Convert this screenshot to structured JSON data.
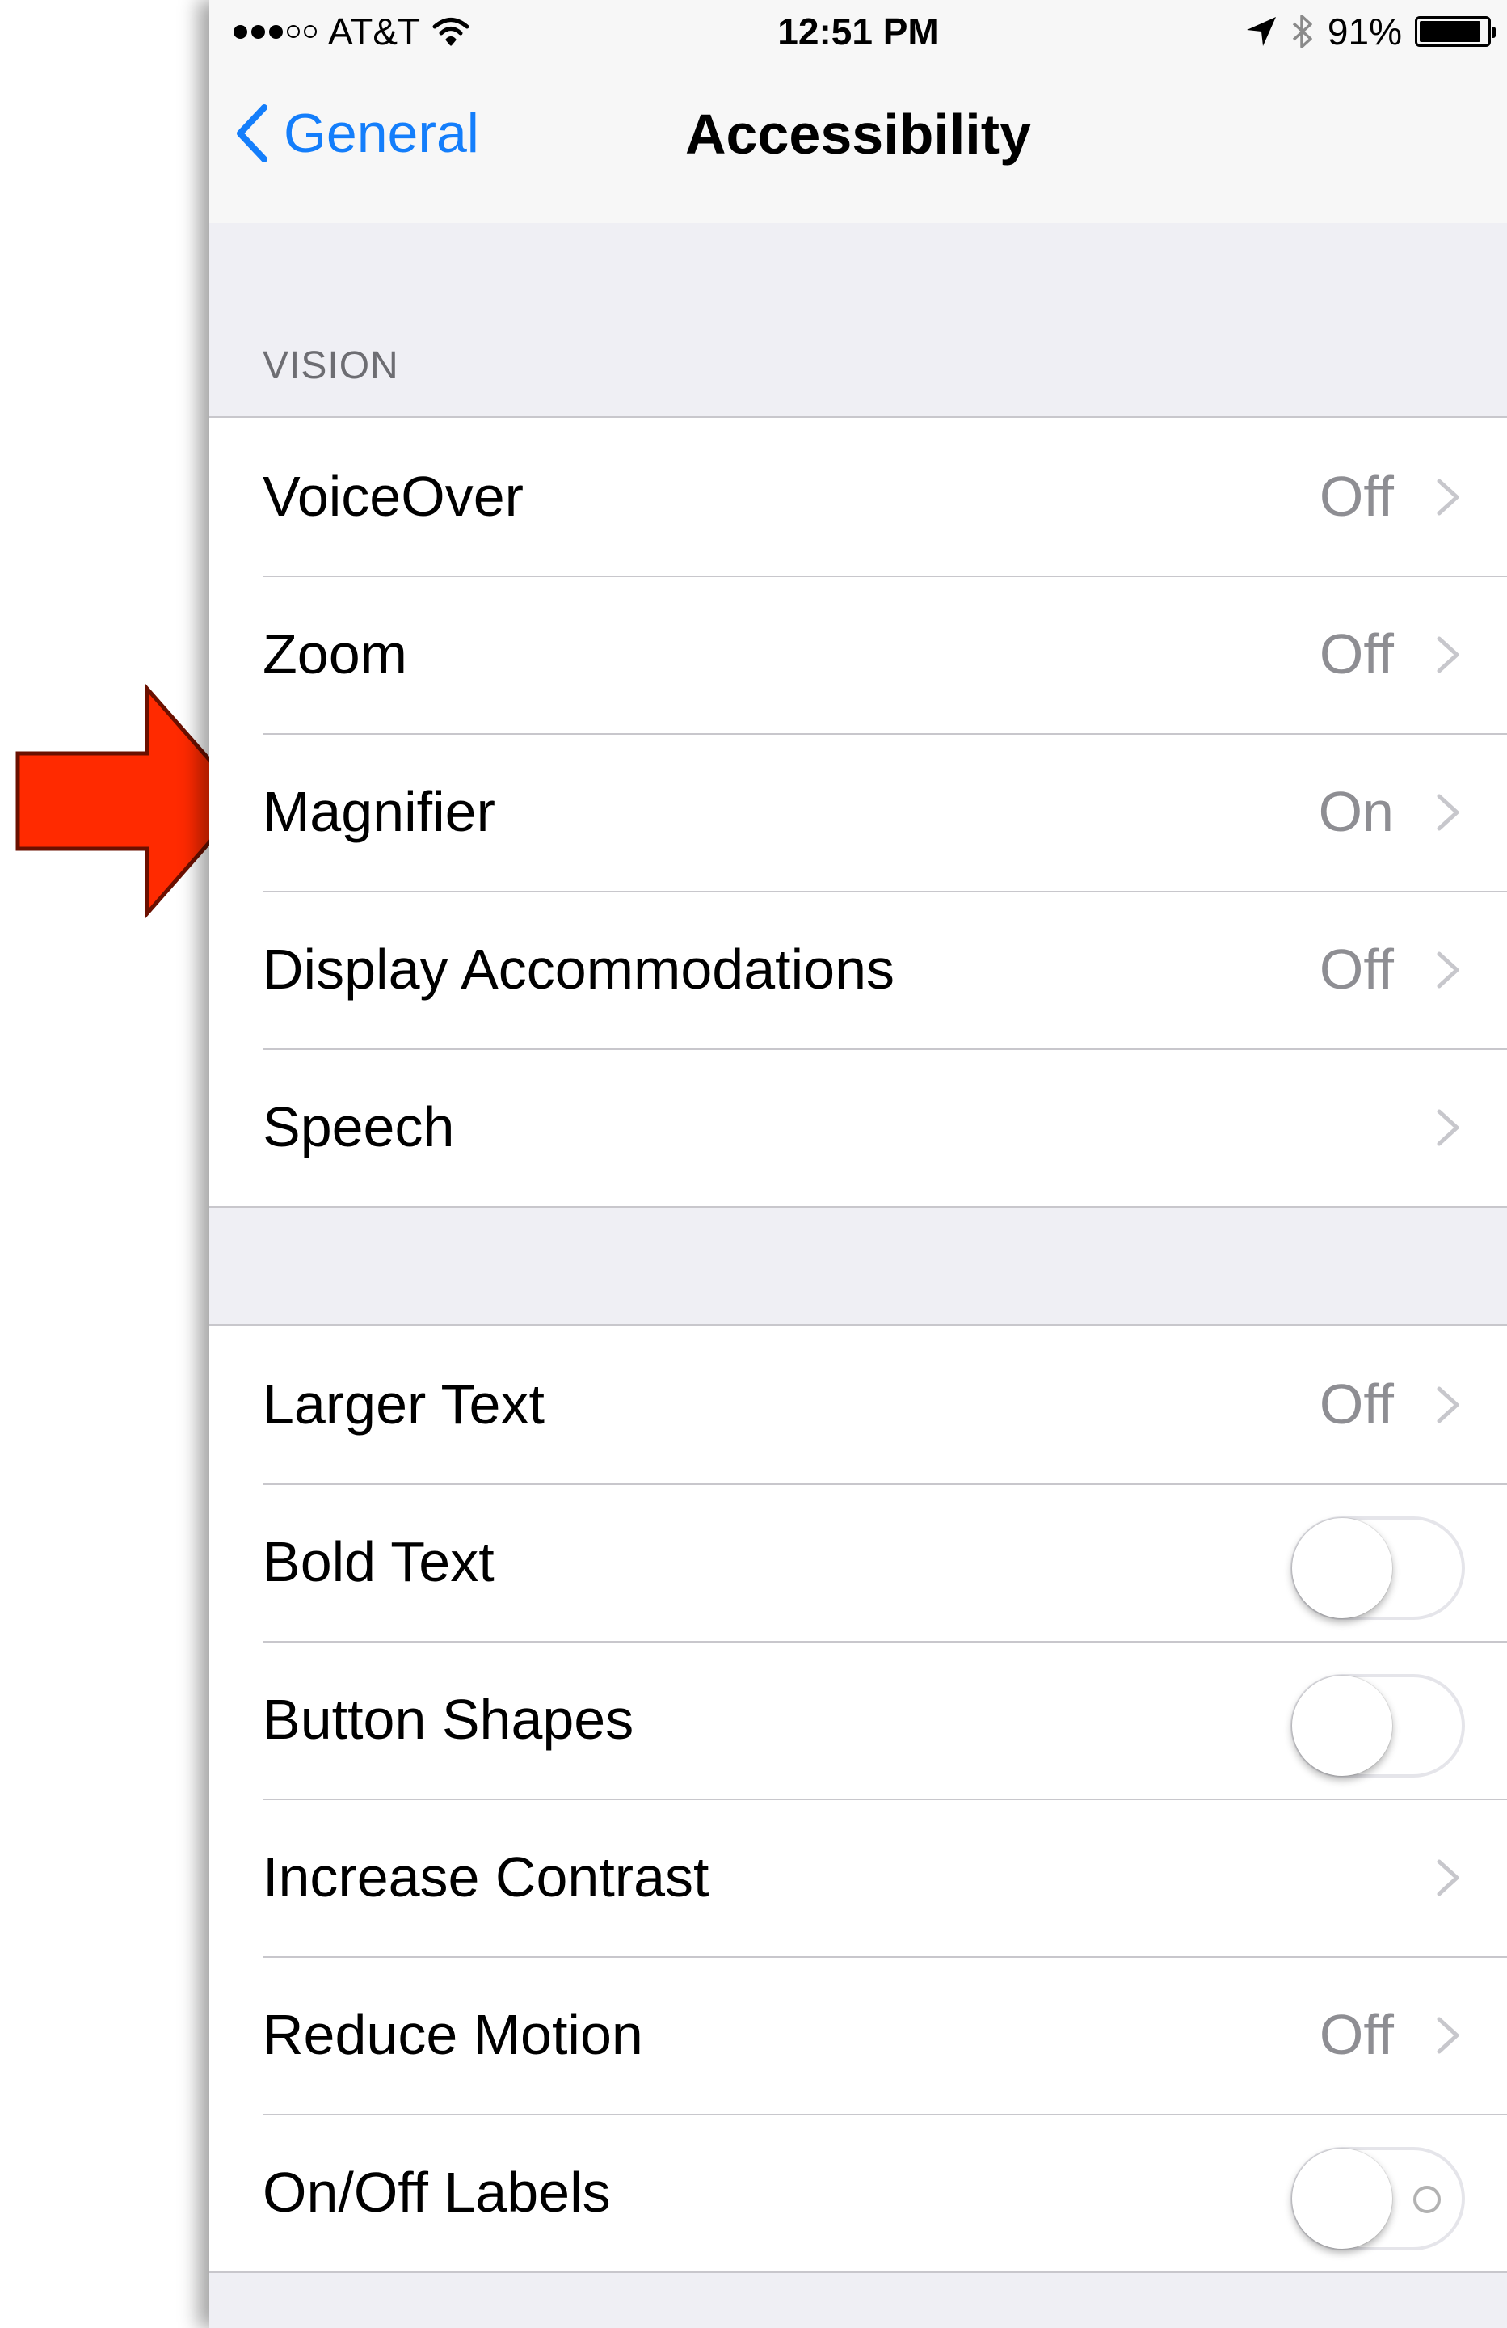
{
  "status_bar": {
    "carrier": "AT&T",
    "time": "12:51 PM",
    "battery": "91%",
    "battery_level": 0.91,
    "icons": [
      "signal-dots-icon",
      "wifi-icon",
      "location-arrow-icon",
      "bluetooth-icon",
      "battery-icon"
    ]
  },
  "nav": {
    "back_label": "General",
    "title": "Accessibility"
  },
  "vision": {
    "header": "VISION",
    "rows": [
      {
        "label": "VoiceOver",
        "value": "Off"
      },
      {
        "label": "Zoom",
        "value": "Off"
      },
      {
        "label": "Magnifier",
        "value": "On"
      },
      {
        "label": "Display Accommodations",
        "value": "Off"
      },
      {
        "label": "Speech",
        "value": ""
      }
    ]
  },
  "text_group": {
    "rows": [
      {
        "label": "Larger Text",
        "value": "Off",
        "type": "disclosure"
      },
      {
        "label": "Bold Text",
        "type": "toggle",
        "on": false
      },
      {
        "label": "Button Shapes",
        "type": "toggle",
        "on": false
      },
      {
        "label": "Increase Contrast",
        "type": "disclosure"
      },
      {
        "label": "Reduce Motion",
        "value": "Off",
        "type": "disclosure"
      },
      {
        "label": "On/Off Labels",
        "type": "toggle",
        "on": false
      }
    ]
  },
  "colors": {
    "accent": "#147efb",
    "background": "#efeff4",
    "separator": "#c8c7cc",
    "secondary_text": "#8e8e93",
    "annotation_arrow": "#ff2a00"
  }
}
